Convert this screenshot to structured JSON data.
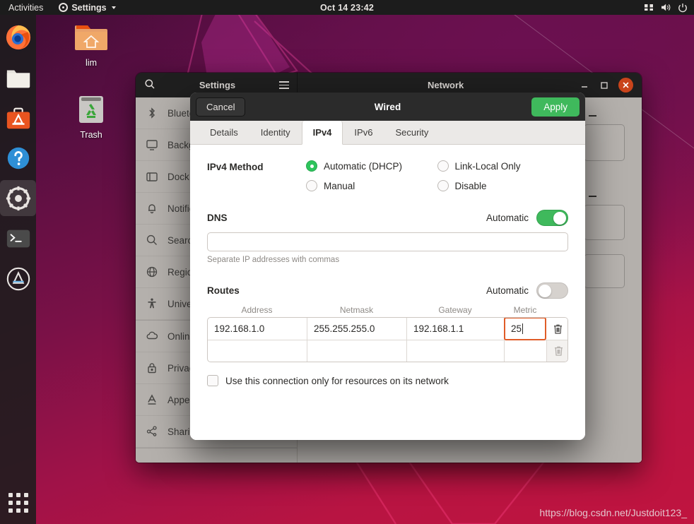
{
  "topbar": {
    "activities": "Activities",
    "app_name": "Settings",
    "clock": "Oct 14 23:42",
    "app_icon": "gear-icon",
    "caret_icon": "chevron-down-icon",
    "tray_icons": [
      "keyboard-icon",
      "volume-icon",
      "power-icon"
    ]
  },
  "dock": {
    "items": [
      {
        "name": "firefox",
        "label": "Firefox",
        "icon": "firefox-icon",
        "active": false
      },
      {
        "name": "files",
        "label": "Files",
        "icon": "folder-icon",
        "active": false
      },
      {
        "name": "ubuntu-software",
        "label": "Ubuntu Software",
        "icon": "software-bag-icon",
        "active": false
      },
      {
        "name": "help",
        "label": "Help",
        "icon": "help-icon",
        "active": false
      },
      {
        "name": "settings",
        "label": "Settings",
        "icon": "gear-icon",
        "active": true
      },
      {
        "name": "terminal",
        "label": "Terminal",
        "icon": "terminal-icon",
        "active": false
      },
      {
        "name": "ubuntu-software-center",
        "label": "Software Center",
        "icon": "amazon-a-circle-icon",
        "active": false
      }
    ],
    "app_grid_label": "Show Applications"
  },
  "desktop": {
    "icons": [
      {
        "name": "home-folder",
        "label": "lim",
        "icon": "home-folder-icon"
      },
      {
        "name": "trash",
        "label": "Trash",
        "icon": "trash-icon"
      }
    ]
  },
  "settings_window": {
    "search_icon": "search-icon",
    "title": "Settings",
    "menu_icon": "hamburger-menu-icon",
    "page_title": "Network",
    "minimize_label": "–",
    "maximize_label": "□",
    "close_label": "✕",
    "sidebar": [
      {
        "label": "Bluetooth",
        "icon": "bluetooth-icon"
      },
      {
        "label": "Background",
        "icon": "monitor-icon"
      },
      {
        "label": "Dock",
        "icon": "dock-icon"
      },
      {
        "label": "Notifications",
        "icon": "bell-icon"
      },
      {
        "label": "Search",
        "icon": "search-icon"
      },
      {
        "label": "Region & Language",
        "icon": "globe-icon"
      },
      {
        "label": "Universal Access",
        "icon": "accessibility-icon"
      },
      {
        "label": "Online Accounts",
        "icon": "cloud-icon"
      },
      {
        "label": "Privacy",
        "icon": "lock-icon"
      },
      {
        "label": "Appearance",
        "icon": "font-a-icon"
      },
      {
        "label": "Sharing",
        "icon": "share-nodes-icon"
      }
    ]
  },
  "dialog": {
    "cancel_label": "Cancel",
    "title": "Wired",
    "apply_label": "Apply",
    "tabs": [
      {
        "label": "Details",
        "selected": false
      },
      {
        "label": "Identity",
        "selected": false
      },
      {
        "label": "IPv4",
        "selected": true
      },
      {
        "label": "IPv6",
        "selected": false
      },
      {
        "label": "Security",
        "selected": false
      }
    ],
    "ipv4_method": {
      "label": "IPv4 Method",
      "options": [
        {
          "label": "Automatic (DHCP)",
          "selected": true
        },
        {
          "label": "Link-Local Only",
          "selected": false
        },
        {
          "label": "Manual",
          "selected": false
        },
        {
          "label": "Disable",
          "selected": false
        }
      ]
    },
    "dns": {
      "title": "DNS",
      "automatic_label": "Automatic",
      "automatic_on": true,
      "value": "",
      "placeholder": "",
      "hint": "Separate IP addresses with commas"
    },
    "routes": {
      "title": "Routes",
      "automatic_label": "Automatic",
      "automatic_on": false,
      "columns": [
        "Address",
        "Netmask",
        "Gateway",
        "Metric"
      ],
      "rows": [
        {
          "address": "192.168.1.0",
          "netmask": "255.255.255.0",
          "gateway": "192.168.1.1",
          "metric": "25",
          "focused_field": "metric",
          "delete_enabled": true
        },
        {
          "address": "",
          "netmask": "",
          "gateway": "",
          "metric": "",
          "focused_field": "",
          "delete_enabled": false
        }
      ],
      "delete_icon": "trash-icon"
    },
    "restrict_checkbox": {
      "label": "Use this connection only for resources on its network",
      "checked": false
    }
  },
  "watermark": {
    "text": "https://blog.csdn.net/Justdoit123_"
  },
  "colors": {
    "accent_green": "#3fb95c",
    "focus_orange": "#e05c28",
    "close_red": "#c9441b",
    "topbar_dark": "#1c1c1c",
    "sidebar_gray": "#b4b0ac"
  }
}
